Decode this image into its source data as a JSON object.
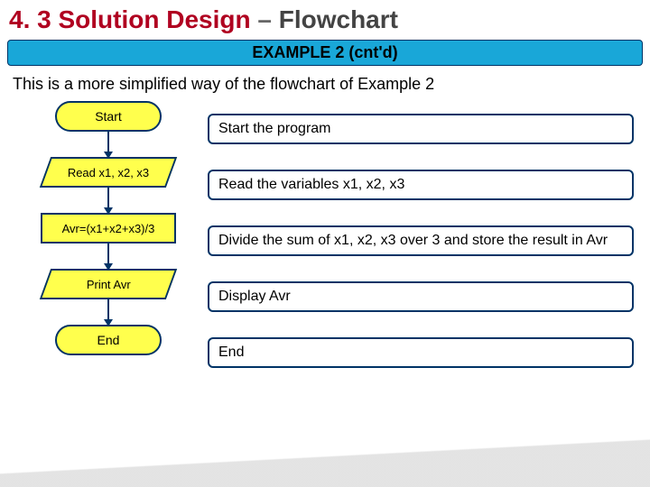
{
  "title": {
    "section": "4. 3 Solution Design",
    "separator": "–",
    "topic": "Flowchart"
  },
  "banner": "EXAMPLE 2 (cnt'd)",
  "intro": "This is a more simplified way of the flowchart of Example 2",
  "steps": [
    {
      "shape_label": "Start",
      "desc": "Start the program"
    },
    {
      "shape_label": "Read x1, x2, x3",
      "desc": "Read the variables x1, x2, x3"
    },
    {
      "shape_label": "Avr=(x1+x2+x3)/3",
      "desc": "Divide the sum of x1, x2, x3 over 3 and store the result in Avr"
    },
    {
      "shape_label": "Print Avr",
      "desc": "Display Avr"
    },
    {
      "shape_label": "End",
      "desc": "End"
    }
  ]
}
